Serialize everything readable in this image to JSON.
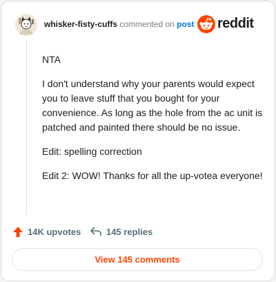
{
  "header": {
    "username": "whisker-fisty-cuffs",
    "commented_text": "commented on",
    "post_link": "post",
    "brand_wordmark": "reddit"
  },
  "comment": {
    "paragraphs": [
      "NTA",
      "I don't understand why your parents would expect you to leave stuff that you bought for your convenience. As long as the hole from the ac unit is patched and painted there should be no issue.",
      "Edit: spelling correction",
      "Edit 2: WOW! Thanks for all the up-votea everyone!"
    ]
  },
  "actions": {
    "upvotes_label": "14K upvotes",
    "replies_label": "145 replies"
  },
  "view_button": "View 145 comments",
  "colors": {
    "brand_orange": "#ff4500",
    "link_blue": "#0079d3",
    "muted_text": "#576f76"
  },
  "icons": [
    "avatar",
    "reddit-logo-icon",
    "upvote-arrow-icon",
    "reply-arrow-icon"
  ]
}
